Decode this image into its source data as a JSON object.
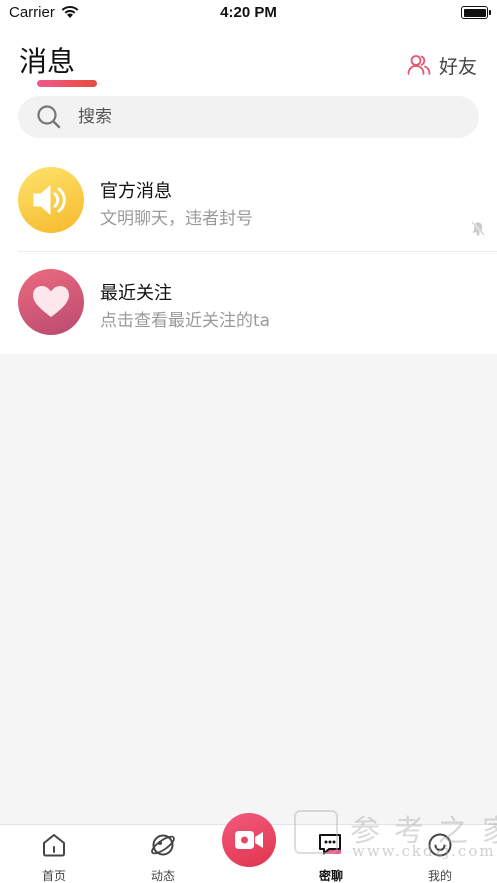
{
  "status_bar": {
    "carrier": "Carrier",
    "time": "4:20 PM"
  },
  "header": {
    "title": "消息",
    "friends_label": "好友"
  },
  "search": {
    "placeholder": "搜索",
    "value": ""
  },
  "conversations": [
    {
      "title": "官方消息",
      "subtitle": "文明聊天，违者封号",
      "icon": "speaker-icon",
      "muted": true
    },
    {
      "title": "最近关注",
      "subtitle": "点击查看最近关注的ta",
      "icon": "heart-icon",
      "muted": false
    }
  ],
  "tabs": [
    {
      "label": "首页",
      "icon": "home-icon",
      "active": false
    },
    {
      "label": "动态",
      "icon": "planet-icon",
      "active": false
    },
    {
      "label": "密聊",
      "icon": "chat-bubble-icon",
      "active": true
    },
    {
      "label": "我的",
      "icon": "smile-icon",
      "active": false
    }
  ],
  "center_button": {
    "icon": "video-camera-icon"
  },
  "watermark": {
    "text": "参考之家",
    "url": "www.ckdzj.com"
  },
  "colors": {
    "accent_gradient_start": "#f25a7c",
    "accent_gradient_end": "#e0354e",
    "official_avatar": "#f9cb45",
    "follow_avatar": "#d85c76",
    "background": "#f5f5f5"
  }
}
